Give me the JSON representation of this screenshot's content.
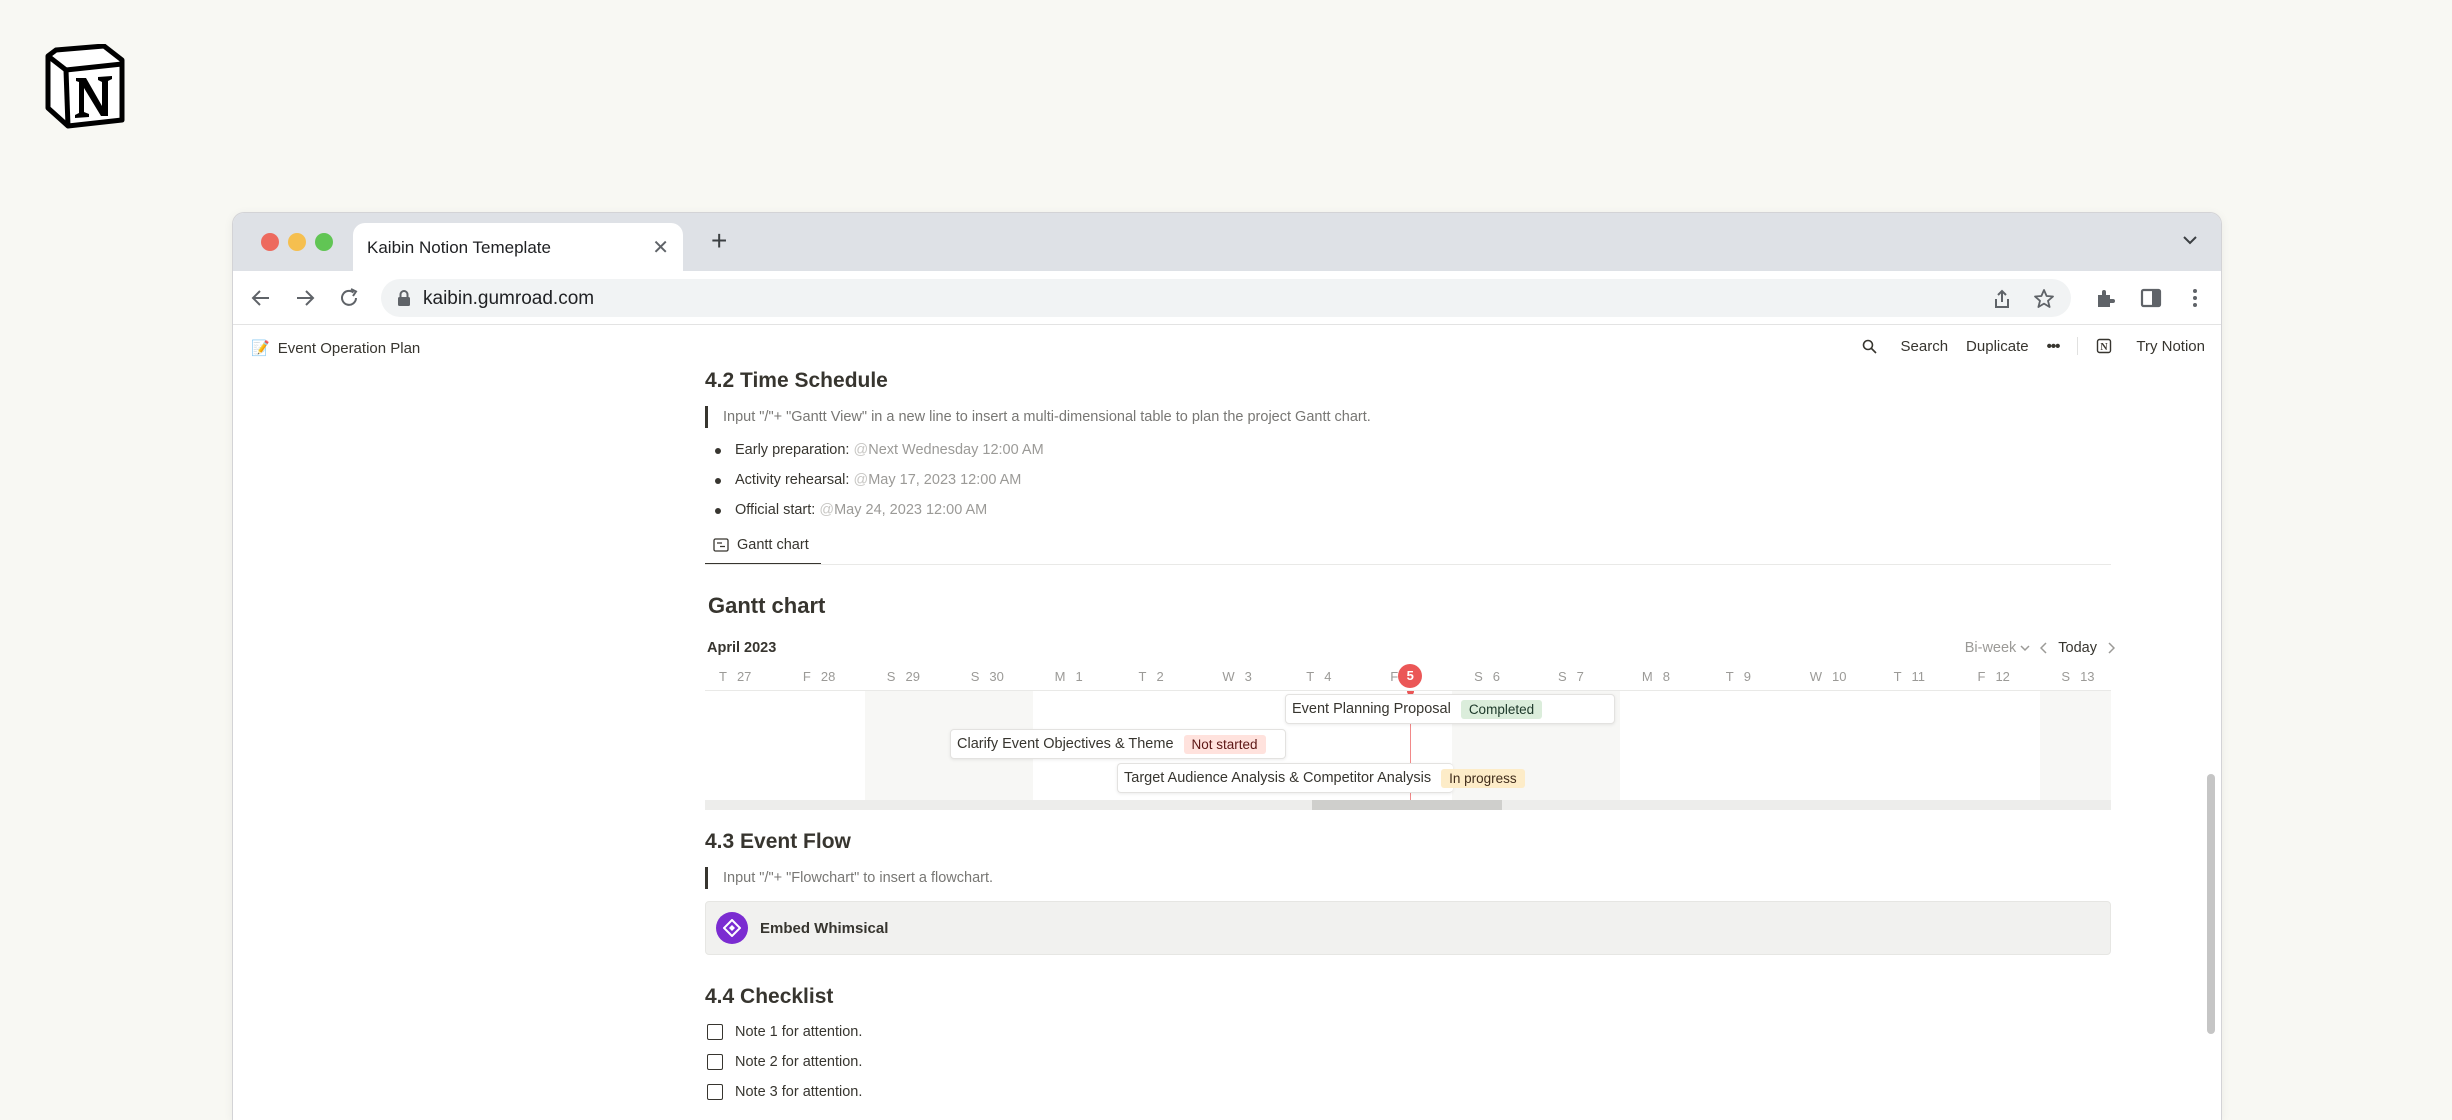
{
  "browser": {
    "tab_title": "Kaibin Notion Temeplate",
    "url": "kaibin.gumroad.com"
  },
  "notion": {
    "breadcrumb": "Event Operation Plan",
    "actions": {
      "search": "Search",
      "duplicate": "Duplicate",
      "more": "•••",
      "try": "Try Notion"
    }
  },
  "section_42": {
    "heading": "4.2 Time Schedule",
    "quote": "Input \"/\"+ \"Gantt View\" in a new line to insert a multi-dimensional table to plan the project Gantt chart.",
    "items": [
      {
        "label": "Early preparation:",
        "at": "@",
        "date": "Next Wednesday 12:00 AM"
      },
      {
        "label": "Activity rehearsal:",
        "at": "@",
        "date": "May 17, 2023 12:00 AM"
      },
      {
        "label": "Official start:",
        "at": "@",
        "date": "May 24, 2023 12:00 AM"
      }
    ],
    "view_tab": "Gantt chart"
  },
  "gantt": {
    "title": "Gantt chart",
    "month": "April 2023",
    "range": "Bi-week",
    "today_button": "Today",
    "days": [
      {
        "dow": "T",
        "num": "27"
      },
      {
        "dow": "F",
        "num": "28"
      },
      {
        "dow": "S",
        "num": "29"
      },
      {
        "dow": "S",
        "num": "30"
      },
      {
        "dow": "M",
        "num": "1"
      },
      {
        "dow": "T",
        "num": "2"
      },
      {
        "dow": "W",
        "num": "3"
      },
      {
        "dow": "T",
        "num": "4"
      },
      {
        "dow": "F",
        "num": "5"
      },
      {
        "dow": "S",
        "num": "6"
      },
      {
        "dow": "S",
        "num": "7"
      },
      {
        "dow": "M",
        "num": "8"
      },
      {
        "dow": "T",
        "num": "9"
      },
      {
        "dow": "W",
        "num": "10"
      },
      {
        "dow": "T",
        "num": "11"
      },
      {
        "dow": "F",
        "num": "12"
      },
      {
        "dow": "S",
        "num": "13"
      }
    ],
    "tasks": [
      {
        "name": "Event Planning Proposal",
        "status": "Completed"
      },
      {
        "name": "Clarify Event Objectives & Theme",
        "status": "Not started"
      },
      {
        "name": "Target Audience Analysis & Competitor Analysis",
        "status": "In progress"
      }
    ]
  },
  "section_43": {
    "heading": "4.3 Event Flow",
    "quote": "Input \"/\"+ \"Flowchart\" to insert a flowchart.",
    "embed": "Embed Whimsical"
  },
  "section_44": {
    "heading": "4.4 Checklist",
    "items": [
      "Note 1 for attention.",
      "Note 2 for attention.",
      "Note 3 for attention."
    ]
  }
}
